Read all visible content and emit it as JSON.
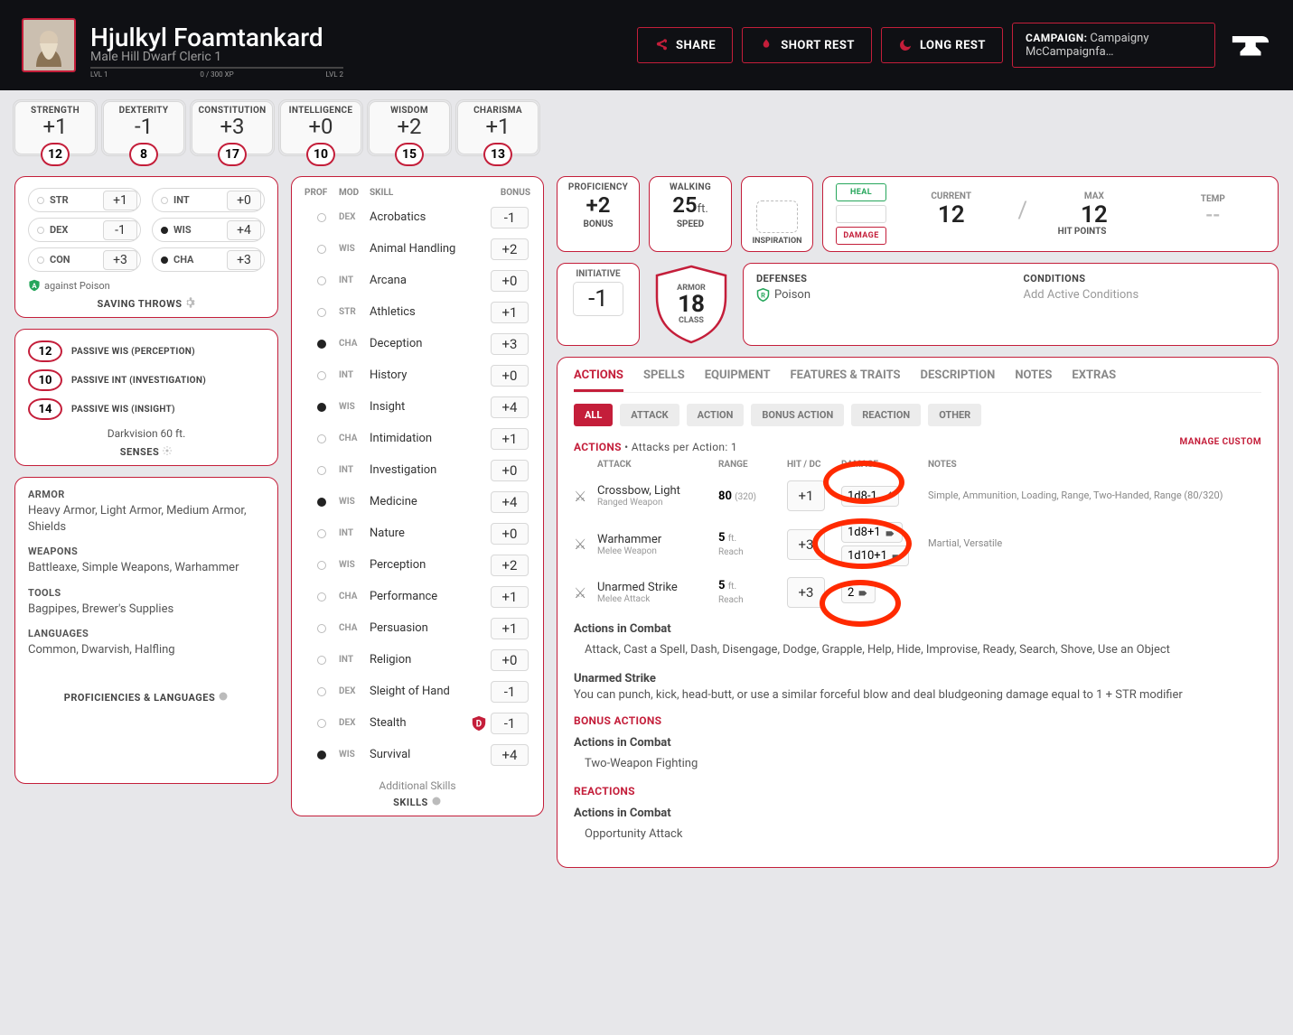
{
  "header": {
    "name": "Hjulkyl Foamtankard",
    "race": "Male  Hill Dwarf  Cleric 1",
    "lvl_left": "LVL 1",
    "lvl_right": "LVL 2",
    "xp": "0 / 300 XP",
    "share": "SHARE",
    "short_rest": "SHORT REST",
    "long_rest": "LONG REST",
    "campaign_label": "CAMPAIGN:",
    "campaign_name": "Campaigny McCampaignfa…"
  },
  "abilities": [
    {
      "name": "STRENGTH",
      "mod": "+1",
      "score": "12"
    },
    {
      "name": "DEXTERITY",
      "mod": "-1",
      "score": "8"
    },
    {
      "name": "CONSTITUTION",
      "mod": "+3",
      "score": "17"
    },
    {
      "name": "INTELLIGENCE",
      "mod": "+0",
      "score": "10"
    },
    {
      "name": "WISDOM",
      "mod": "+2",
      "score": "15"
    },
    {
      "name": "CHARISMA",
      "mod": "+1",
      "score": "13"
    }
  ],
  "saving_throws": {
    "title": "SAVING THROWS",
    "rows": [
      {
        "abbr": "STR",
        "val": "+1",
        "prof": false
      },
      {
        "abbr": "INT",
        "val": "+0",
        "prof": false
      },
      {
        "abbr": "DEX",
        "val": "-1",
        "prof": false
      },
      {
        "abbr": "WIS",
        "val": "+4",
        "prof": true
      },
      {
        "abbr": "CON",
        "val": "+3",
        "prof": false
      },
      {
        "abbr": "CHA",
        "val": "+3",
        "prof": true
      }
    ],
    "bonus_note": "against Poison"
  },
  "senses": {
    "title": "SENSES",
    "rows": [
      {
        "v": "12",
        "l": "PASSIVE WIS (PERCEPTION)"
      },
      {
        "v": "10",
        "l": "PASSIVE INT (INVESTIGATION)"
      },
      {
        "v": "14",
        "l": "PASSIVE WIS (INSIGHT)"
      }
    ],
    "extra": "Darkvision 60 ft."
  },
  "prof_lang": {
    "title": "PROFICIENCIES & LANGUAGES",
    "sections": [
      {
        "h": "ARMOR",
        "b": "Heavy Armor, Light Armor, Medium Armor, Shields"
      },
      {
        "h": "WEAPONS",
        "b": "Battleaxe, Simple Weapons, Warhammer"
      },
      {
        "h": "TOOLS",
        "b": "Bagpipes, Brewer's Supplies"
      },
      {
        "h": "LANGUAGES",
        "b": "Common, Dwarvish, Halfling"
      }
    ]
  },
  "skills": {
    "title": "SKILLS",
    "hdr": {
      "prof": "PROF",
      "mod": "MOD",
      "skill": "SKILL",
      "bonus": "BONUS"
    },
    "additional": "Additional Skills",
    "rows": [
      {
        "prof": false,
        "mod": "DEX",
        "name": "Acrobatics",
        "bonus": "-1"
      },
      {
        "prof": false,
        "mod": "WIS",
        "name": "Animal Handling",
        "bonus": "+2"
      },
      {
        "prof": false,
        "mod": "INT",
        "name": "Arcana",
        "bonus": "+0"
      },
      {
        "prof": false,
        "mod": "STR",
        "name": "Athletics",
        "bonus": "+1"
      },
      {
        "prof": true,
        "mod": "CHA",
        "name": "Deception",
        "bonus": "+3"
      },
      {
        "prof": false,
        "mod": "INT",
        "name": "History",
        "bonus": "+0"
      },
      {
        "prof": true,
        "mod": "WIS",
        "name": "Insight",
        "bonus": "+4"
      },
      {
        "prof": false,
        "mod": "CHA",
        "name": "Intimidation",
        "bonus": "+1"
      },
      {
        "prof": false,
        "mod": "INT",
        "name": "Investigation",
        "bonus": "+0"
      },
      {
        "prof": true,
        "mod": "WIS",
        "name": "Medicine",
        "bonus": "+4"
      },
      {
        "prof": false,
        "mod": "INT",
        "name": "Nature",
        "bonus": "+0"
      },
      {
        "prof": false,
        "mod": "WIS",
        "name": "Perception",
        "bonus": "+2"
      },
      {
        "prof": false,
        "mod": "CHA",
        "name": "Performance",
        "bonus": "+1"
      },
      {
        "prof": false,
        "mod": "CHA",
        "name": "Persuasion",
        "bonus": "+1"
      },
      {
        "prof": false,
        "mod": "INT",
        "name": "Religion",
        "bonus": "+0"
      },
      {
        "prof": false,
        "mod": "DEX",
        "name": "Sleight of Hand",
        "bonus": "-1"
      },
      {
        "prof": false,
        "mod": "DEX",
        "name": "Stealth",
        "bonus": "-1",
        "disadv": true
      },
      {
        "prof": true,
        "mod": "WIS",
        "name": "Survival",
        "bonus": "+4"
      }
    ]
  },
  "quick": {
    "prof": {
      "l": "PROFICIENCY",
      "v": "+2",
      "l2": "BONUS"
    },
    "speed": {
      "l": "WALKING",
      "v": "25",
      "u": "ft.",
      "l2": "SPEED"
    },
    "insp": "INSPIRATION",
    "init": {
      "l": "INITIATIVE",
      "v": "-1"
    },
    "ac": {
      "top": "ARMOR",
      "v": "18",
      "bot": "CLASS"
    },
    "hp": {
      "heal": "HEAL",
      "damage": "DAMAGE",
      "cur_l": "CURRENT",
      "cur_v": "12",
      "max_l": "MAX",
      "max_v": "12",
      "tmp_l": "TEMP",
      "tmp_v": "--",
      "foot": "HIT POINTS"
    }
  },
  "defcond": {
    "def_h": "DEFENSES",
    "def_item": "Poison",
    "cond_h": "CONDITIONS",
    "cond_ph": "Add Active Conditions"
  },
  "detail": {
    "tabs": [
      "ACTIONS",
      "SPELLS",
      "EQUIPMENT",
      "FEATURES & TRAITS",
      "DESCRIPTION",
      "NOTES",
      "EXTRAS"
    ],
    "active_tab": 0,
    "filters": [
      "ALL",
      "ATTACK",
      "ACTION",
      "BONUS ACTION",
      "REACTION",
      "OTHER"
    ],
    "active_filter": 0,
    "actions_header": "ACTIONS",
    "apx": " • Attacks per Action: 1",
    "manage": "MANAGE CUSTOM",
    "cols": {
      "attack": "ATTACK",
      "range": "RANGE",
      "hit": "HIT / DC",
      "dmg": "DAMAGE",
      "notes": "NOTES"
    },
    "attacks": [
      {
        "name": "Crossbow, Light",
        "sub": "Ranged Weapon",
        "range": "80",
        "range_sub": "(320)",
        "hit": "+1",
        "dmg": [
          "1d8-1"
        ],
        "dmg_type": "pierce",
        "notes": "Simple, Ammunition, Loading, Range, Two-Handed, Range (80/320)"
      },
      {
        "name": "Warhammer",
        "sub": "Melee Weapon",
        "range": "5",
        "range_unit": "ft.",
        "range_sub": "Reach",
        "hit": "+3",
        "dmg": [
          "1d8+1",
          "1d10+1"
        ],
        "dmg_type": "blunt",
        "notes": "Martial, Versatile"
      },
      {
        "name": "Unarmed Strike",
        "sub": "Melee Attack",
        "range": "5",
        "range_unit": "ft.",
        "range_sub": "Reach",
        "hit": "+3",
        "dmg": [
          "2"
        ],
        "dmg_type": "blunt",
        "notes": ""
      }
    ],
    "actions_combat_h": "Actions in Combat",
    "actions_combat": "Attack, Cast a Spell, Dash, Disengage, Dodge, Grapple, Help, Hide, Improvise, Ready, Search, Shove, Use an Object",
    "unarmed_h": "Unarmed Strike",
    "unarmed_b": "You can punch, kick, head-butt, or use a similar forceful blow and deal bludgeoning damage equal to 1 + STR modifier",
    "bonus_h": "BONUS ACTIONS",
    "bonus_sub": "Actions in Combat",
    "bonus_b": "Two-Weapon Fighting",
    "react_h": "REACTIONS",
    "react_sub": "Actions in Combat",
    "react_b": "Opportunity Attack"
  }
}
